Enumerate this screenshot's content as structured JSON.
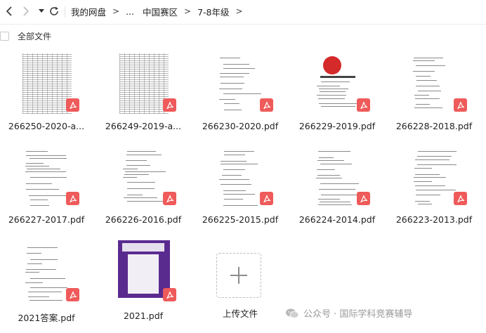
{
  "nav": {
    "back_icon": "chevron-left-icon",
    "forward_icon": "chevron-right-icon",
    "history_icon": "caret-down-icon",
    "refresh_icon": "refresh-icon"
  },
  "breadcrumb": {
    "root": "我的网盘",
    "ellipsis": "...",
    "level1": "中国赛区",
    "level2": "7-8年级",
    "separator": ">"
  },
  "select_all_label": "全部文件",
  "files": [
    {
      "name": "266250-2020-a...",
      "thumb": "grid"
    },
    {
      "name": "266249-2019-a...",
      "thumb": "grid"
    },
    {
      "name": "266230-2020.pdf",
      "thumb": "doc"
    },
    {
      "name": "266229-2019.pdf",
      "thumb": "doc-red"
    },
    {
      "name": "266228-2018.pdf",
      "thumb": "doc"
    },
    {
      "name": "266227-2017.pdf",
      "thumb": "doc"
    },
    {
      "name": "266226-2016.pdf",
      "thumb": "doc"
    },
    {
      "name": "266225-2015.pdf",
      "thumb": "doc"
    },
    {
      "name": "266224-2014.pdf",
      "thumb": "doc"
    },
    {
      "name": "266223-2013.pdf",
      "thumb": "doc"
    },
    {
      "name": "2021答案.pdf",
      "thumb": "doc"
    },
    {
      "name": "2021.pdf",
      "thumb": "purple"
    }
  ],
  "upload_label": "上传文件",
  "watermark": {
    "text": "公众号 · 国际学科竞赛辅导",
    "icon": "wechat-icon"
  },
  "colors": {
    "pdf_badge": "#ef5a5a",
    "purple_cover": "#5a2b8f"
  }
}
